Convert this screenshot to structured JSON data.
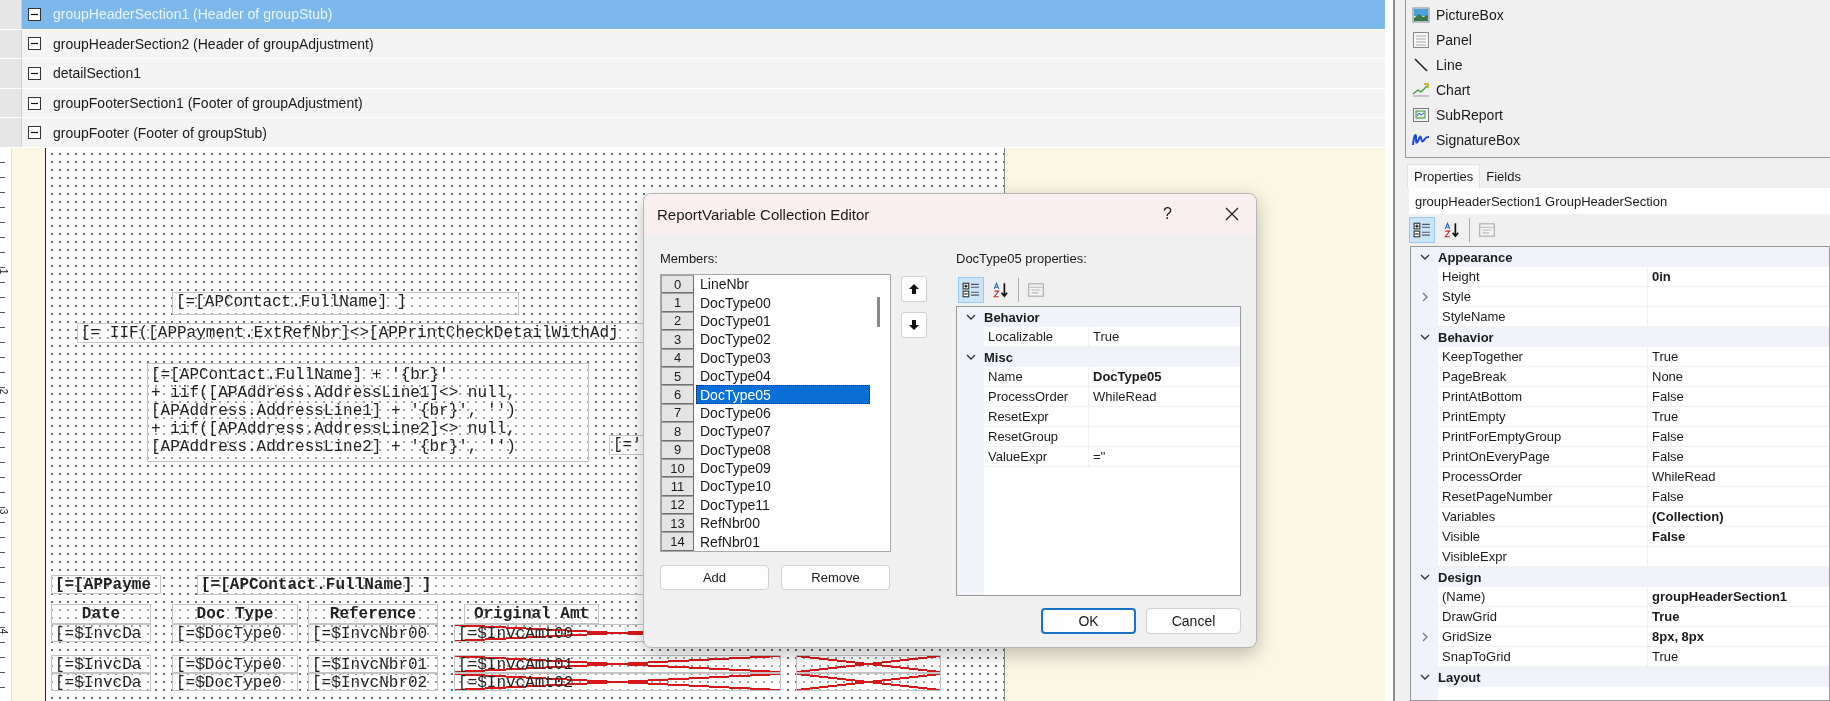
{
  "sections": [
    {
      "label": "groupHeaderSection1 (Header of groupStub)",
      "selected": true,
      "expanded": true
    },
    {
      "label": "groupHeaderSection2 (Header of groupAdjustment)",
      "selected": false,
      "expanded": true
    },
    {
      "label": "detailSection1",
      "selected": false,
      "expanded": true
    },
    {
      "label": "groupFooterSection1 (Footer of groupAdjustment)",
      "selected": false,
      "expanded": true
    },
    {
      "label": "groupFooter (Footer of groupStub)",
      "selected": false,
      "expanded": true
    }
  ],
  "ruler": {
    "labels": [
      "1",
      "2",
      "3",
      "4"
    ]
  },
  "canvas": {
    "fields": [
      {
        "kind": "plain",
        "text": "[=[APContact.FullName] ]"
      },
      {
        "kind": "plain",
        "text": "[= IIF([APPayment.ExtRefNbr]<>[APPrintCheckDetailWithAdj"
      },
      {
        "kind": "multiline",
        "lines": [
          "[=[APContact.FullName] + '{br}'",
          "+ iif([APAddress.AddressLine1]<> null,",
          "[APAddress.AddressLine1] + '{br}', '')",
          "+ iif([APAddress.AddressLine2]<> null,",
          "[APAddress.AddressLine2] + '{br}', '')"
        ]
      },
      {
        "kind": "plain",
        "text": "[='"
      },
      {
        "kind": "bold",
        "text": "[=[APPayme"
      },
      {
        "kind": "bold",
        "text": "[=[APContact.FullName] ]"
      }
    ],
    "table": {
      "columns": [
        "Date",
        "Doc Type",
        "Reference",
        "Original Amt"
      ],
      "rows": [
        [
          {
            "text": "[=$InvcDa",
            "error": false
          },
          {
            "text": "[=$DocType0",
            "error": false
          },
          {
            "text": "[=$InvcNbr00",
            "error": false
          },
          {
            "text": "[=$InvcAmt00",
            "error": true
          }
        ],
        [
          {
            "text": "[=$InvcDa",
            "error": false
          },
          {
            "text": "[=$DocType0",
            "error": false
          },
          {
            "text": "[=$InvcNbr01",
            "error": false
          },
          {
            "text": "[=$InvcAmt01",
            "error": true
          },
          {
            "error": true
          }
        ],
        [
          {
            "text": "[=$InvcDa",
            "error": false
          },
          {
            "text": "[=$DocType0",
            "error": false
          },
          {
            "text": "[=$InvcNbr02",
            "error": false
          },
          {
            "text": "[=$InvcAmt02",
            "error": true
          },
          {
            "error": true
          }
        ]
      ]
    }
  },
  "toolbox": {
    "items": [
      "PictureBox",
      "Panel",
      "Line",
      "Chart",
      "SubReport",
      "SignatureBox"
    ]
  },
  "panel_tabs": [
    {
      "label": "Properties",
      "selected": true
    },
    {
      "label": "Fields",
      "selected": false
    }
  ],
  "object_selector": "groupHeaderSection1 GroupHeaderSection",
  "property_toolbar": [
    {
      "kind": "categorized",
      "selected": true
    },
    {
      "kind": "alphabetical",
      "selected": false
    },
    {
      "kind": "pages",
      "selected": false
    }
  ],
  "property_grid": {
    "categories": [
      {
        "name": "Appearance",
        "expanded": true,
        "properties": [
          {
            "name": "Height",
            "value": "0in",
            "bold": true
          },
          {
            "name": "Style",
            "expandable": true
          },
          {
            "name": "StyleName"
          }
        ]
      },
      {
        "name": "Behavior",
        "expanded": true,
        "properties": [
          {
            "name": "KeepTogether",
            "value": "True"
          },
          {
            "name": "PageBreak",
            "value": "None"
          },
          {
            "name": "PrintAtBottom",
            "value": "False"
          },
          {
            "name": "PrintEmpty",
            "value": "True"
          },
          {
            "name": "PrintForEmptyGroup",
            "value": "False"
          },
          {
            "name": "PrintOnEveryPage",
            "value": "False"
          },
          {
            "name": "ProcessOrder",
            "value": "WhileRead"
          },
          {
            "name": "ResetPageNumber",
            "value": "False"
          },
          {
            "name": "Variables",
            "value": "(Collection)",
            "bold": true
          },
          {
            "name": "Visible",
            "value": "False",
            "bold": true
          },
          {
            "name": "VisibleExpr"
          }
        ]
      },
      {
        "name": "Design",
        "expanded": true,
        "properties": [
          {
            "name": "(Name)",
            "value": "groupHeaderSection1",
            "bold": true
          },
          {
            "name": "DrawGrid",
            "value": "True",
            "bold": true
          },
          {
            "name": "GridSize",
            "value": "8px, 8px",
            "bold": true,
            "expandable": true
          },
          {
            "name": "SnapToGrid",
            "value": "True"
          }
        ]
      },
      {
        "name": "Layout",
        "expanded": true
      }
    ]
  },
  "dialog": {
    "title": "ReportVariable Collection Editor",
    "help": "?",
    "members_label": "Members:",
    "members": [
      {
        "index": "0",
        "name": "LineNbr",
        "selected": false
      },
      {
        "index": "1",
        "name": "DocType00",
        "selected": false
      },
      {
        "index": "2",
        "name": "DocType01",
        "selected": false
      },
      {
        "index": "3",
        "name": "DocType02",
        "selected": false
      },
      {
        "index": "4",
        "name": "DocType03",
        "selected": false
      },
      {
        "index": "5",
        "name": "DocType04",
        "selected": false
      },
      {
        "index": "6",
        "name": "DocType05",
        "selected": true
      },
      {
        "index": "7",
        "name": "DocType06",
        "selected": false
      },
      {
        "index": "8",
        "name": "DocType07",
        "selected": false
      },
      {
        "index": "9",
        "name": "DocType08",
        "selected": false
      },
      {
        "index": "10",
        "name": "DocType09",
        "selected": false
      },
      {
        "index": "11",
        "name": "DocType10",
        "selected": false
      },
      {
        "index": "12",
        "name": "DocType11",
        "selected": false
      },
      {
        "index": "13",
        "name": "RefNbr00",
        "selected": false
      },
      {
        "index": "14",
        "name": "RefNbr01",
        "selected": false
      }
    ],
    "list_buttons": [
      "Add",
      "Remove"
    ],
    "properties_label": "DocType05 properties:",
    "toolbar": [
      {
        "kind": "categorized",
        "selected": true
      },
      {
        "kind": "alphabetical",
        "selected": false
      },
      {
        "kind": "pages",
        "selected": false
      }
    ],
    "grid": {
      "categories": [
        {
          "name": "Behavior",
          "expanded": true,
          "properties": [
            {
              "name": "Localizable",
              "value": "True"
            }
          ]
        },
        {
          "name": "Misc",
          "expanded": true,
          "properties": [
            {
              "name": "Name",
              "value": "DocType05",
              "bold": true
            },
            {
              "name": "ProcessOrder",
              "value": "WhileRead"
            },
            {
              "name": "ResetExpr"
            },
            {
              "name": "ResetGroup"
            },
            {
              "name": "ValueExpr",
              "value": "=''"
            }
          ]
        }
      ]
    },
    "footer_buttons": [
      {
        "label": "OK",
        "default": true
      },
      {
        "label": "Cancel",
        "default": false
      }
    ]
  }
}
